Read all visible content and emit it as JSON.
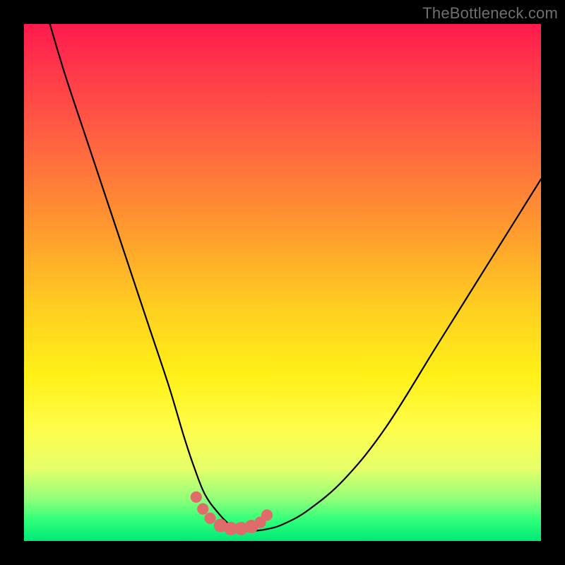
{
  "watermark": "TheBottleneck.com",
  "chart_data": {
    "type": "line",
    "title": "",
    "xlabel": "",
    "ylabel": "",
    "xlim": [
      0,
      100
    ],
    "ylim": [
      0,
      100
    ],
    "series": [
      {
        "name": "bottleneck-curve",
        "x": [
          5,
          8,
          12,
          16,
          20,
          24,
          28,
          31,
          33,
          35,
          37.5,
          40,
          42.5,
          45,
          47,
          50,
          55,
          62,
          70,
          80,
          90,
          100
        ],
        "y": [
          100,
          90,
          78,
          66,
          54,
          42,
          30,
          20,
          14,
          9,
          5.5,
          3,
          2,
          2,
          2.3,
          3.2,
          6,
          12,
          22,
          38,
          54,
          70
        ]
      }
    ],
    "markers": {
      "name": "highlight-dots",
      "color": "#e06b6b",
      "x": [
        33.3,
        34.6,
        36.0,
        38.0,
        40.0,
        42.0,
        44.0,
        45.7,
        47.0
      ],
      "y": [
        8.5,
        6.2,
        4.4,
        3.0,
        2.4,
        2.4,
        2.8,
        3.6,
        5.0
      ],
      "r": [
        1.1,
        1.1,
        1.1,
        1.3,
        1.3,
        1.3,
        1.3,
        1.1,
        1.1
      ]
    }
  }
}
